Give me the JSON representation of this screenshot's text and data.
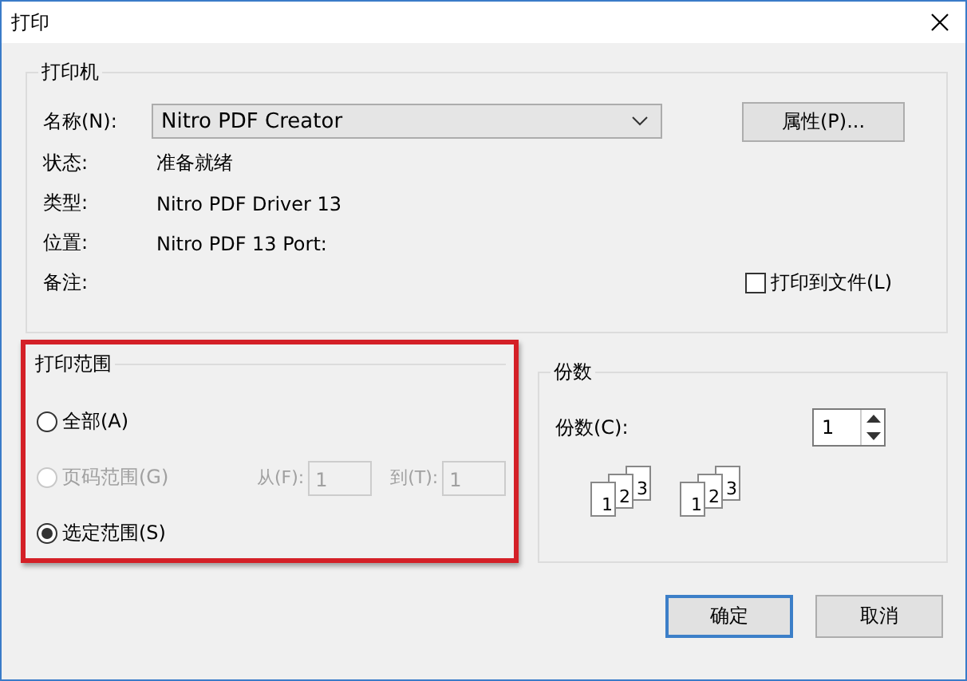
{
  "window": {
    "title": "打印"
  },
  "printer": {
    "title": "打印机",
    "name_label": "名称(N):",
    "name_value": "Nitro PDF Creator",
    "properties_button": "属性(P)...",
    "details": [
      {
        "label": "状态:",
        "value": "准备就绪"
      },
      {
        "label": "类型:",
        "value": "Nitro PDF Driver 13"
      },
      {
        "label": "位置:",
        "value": "Nitro PDF 13 Port:"
      },
      {
        "label": "备注:"
      }
    ],
    "print_to_file": {
      "label": "打印到文件(L)",
      "checked": false
    }
  },
  "range": {
    "title": "打印范围",
    "highlighted": true,
    "options": [
      {
        "label": "全部(A)",
        "selected": false,
        "disabled": false
      },
      {
        "label": "页码范围(G)",
        "selected": false,
        "disabled": true,
        "from_label": "从(F):",
        "from_value": "1",
        "to_label": "到(T):",
        "to_value": "1"
      },
      {
        "label": "选定范围(S)",
        "selected": true,
        "disabled": false
      }
    ]
  },
  "copies": {
    "title": "份数",
    "label": "份数(C):",
    "value": "1",
    "collate_stacks": [
      [
        "1",
        "2",
        "3"
      ],
      [
        "1",
        "2",
        "3"
      ]
    ]
  },
  "buttons": [
    {
      "label": "确定",
      "default": true
    },
    {
      "label": "取消",
      "default": false
    }
  ]
}
